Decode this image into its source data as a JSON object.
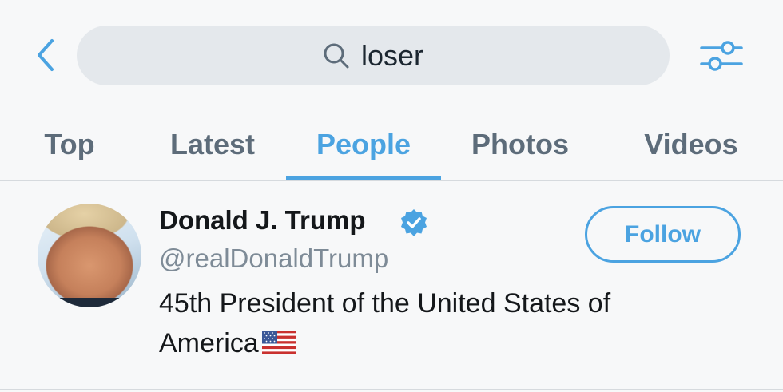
{
  "header": {
    "back_icon": "chevron-left-icon",
    "search": {
      "icon": "search-icon",
      "query": "loser"
    },
    "filter_icon": "sliders-icon",
    "accent_color": "#4ba3e1"
  },
  "tabs": [
    {
      "label": "Top",
      "active": false
    },
    {
      "label": "Latest",
      "active": false
    },
    {
      "label": "People",
      "active": true
    },
    {
      "label": "Photos",
      "active": false
    },
    {
      "label": "Videos",
      "active": false
    }
  ],
  "results": [
    {
      "display_name": "Donald J. Trump",
      "verified": true,
      "handle": "@realDonaldTrump",
      "bio": "45th President of the United States of America",
      "bio_emoji": "us-flag-icon",
      "follow_label": "Follow"
    }
  ]
}
